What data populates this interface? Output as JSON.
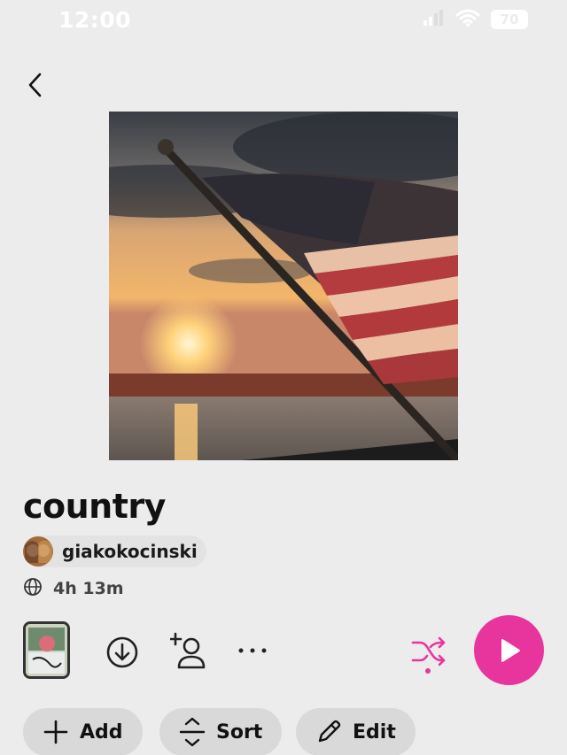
{
  "status_bar": {
    "time": "12:00",
    "battery": "70"
  },
  "playlist": {
    "title": "country",
    "owner": "giakokocinski",
    "duration": "4h 13m"
  },
  "actions": {
    "add_label": "Add",
    "sort_label": "Sort",
    "edit_label": "Edit"
  },
  "colors": {
    "accent": "#e8359e",
    "background": "#ececec"
  }
}
